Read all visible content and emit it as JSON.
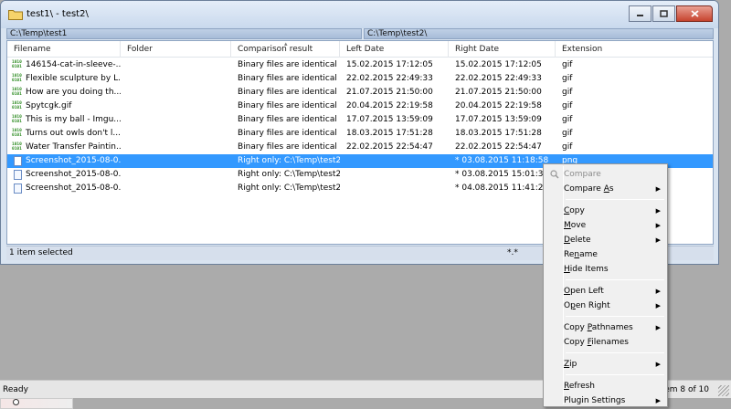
{
  "window": {
    "title": "test1\\ - test2\\",
    "left_path": "C:\\Temp\\test1",
    "right_path": "C:\\Temp\\test2\\"
  },
  "columns": [
    "Filename",
    "Folder",
    "Comparison result",
    "Left Date",
    "Right Date",
    "Extension"
  ],
  "rows": [
    {
      "name": "146154-cat-in-sleeve-...",
      "folder": "",
      "result": "Binary files are identical",
      "left_date": "15.02.2015 17:12:05",
      "right_date": "15.02.2015 17:12:05",
      "ext": "gif",
      "icon": "binary-file-icon"
    },
    {
      "name": "Flexible sculpture by L...",
      "folder": "",
      "result": "Binary files are identical",
      "left_date": "22.02.2015 22:49:33",
      "right_date": "22.02.2015 22:49:33",
      "ext": "gif",
      "icon": "binary-file-icon"
    },
    {
      "name": "How are you doing th...",
      "folder": "",
      "result": "Binary files are identical",
      "left_date": "21.07.2015 21:50:00",
      "right_date": "21.07.2015 21:50:00",
      "ext": "gif",
      "icon": "binary-file-icon"
    },
    {
      "name": "Spytcgk.gif",
      "folder": "",
      "result": "Binary files are identical",
      "left_date": "20.04.2015 22:19:58",
      "right_date": "20.04.2015 22:19:58",
      "ext": "gif",
      "icon": "binary-file-icon"
    },
    {
      "name": "This is my ball - Imgu...",
      "folder": "",
      "result": "Binary files are identical",
      "left_date": "17.07.2015 13:59:09",
      "right_date": "17.07.2015 13:59:09",
      "ext": "gif",
      "icon": "binary-file-icon"
    },
    {
      "name": "Turns out owls don't l...",
      "folder": "",
      "result": "Binary files are identical",
      "left_date": "18.03.2015 17:51:28",
      "right_date": "18.03.2015 17:51:28",
      "ext": "gif",
      "icon": "binary-file-icon"
    },
    {
      "name": "Water Transfer Paintin...",
      "folder": "",
      "result": "Binary files are identical",
      "left_date": "22.02.2015 22:54:47",
      "right_date": "22.02.2015 22:54:47",
      "ext": "gif",
      "icon": "binary-file-icon"
    },
    {
      "name": "Screenshot_2015-08-0...",
      "folder": "",
      "result": "Right only: C:\\Temp\\test2",
      "left_date": "",
      "right_date": "* 03.08.2015 11:18:58",
      "ext": "png",
      "icon": "document-icon",
      "selected": true
    },
    {
      "name": "Screenshot_2015-08-0...",
      "folder": "",
      "result": "Right only: C:\\Temp\\test2",
      "left_date": "",
      "right_date": "* 03.08.2015 15:01:37",
      "ext": "",
      "icon": "document-icon"
    },
    {
      "name": "Screenshot_2015-08-0...",
      "folder": "",
      "result": "Right only: C:\\Temp\\test2",
      "left_date": "",
      "right_date": "* 04.08.2015 11:41:26",
      "ext": "",
      "icon": "document-icon"
    }
  ],
  "status": {
    "selection": "1 item selected",
    "filter": "*.*",
    "app": "Ready",
    "position": "tem 8 of 10"
  },
  "menu": {
    "items": [
      {
        "pre": "",
        "ul": "",
        "post": "Compare",
        "disabled": true,
        "submenu": false,
        "icon": "compare-icon"
      },
      {
        "pre": "Compare ",
        "ul": "A",
        "post": "s",
        "submenu": true
      },
      {
        "sep": true
      },
      {
        "pre": "",
        "ul": "C",
        "post": "opy",
        "submenu": true
      },
      {
        "pre": "",
        "ul": "M",
        "post": "ove",
        "submenu": true
      },
      {
        "pre": "",
        "ul": "D",
        "post": "elete",
        "submenu": true
      },
      {
        "pre": "Re",
        "ul": "n",
        "post": "ame",
        "submenu": false
      },
      {
        "pre": "",
        "ul": "H",
        "post": "ide Items",
        "submenu": false
      },
      {
        "sep": true
      },
      {
        "pre": "",
        "ul": "O",
        "post": "pen Left",
        "submenu": true
      },
      {
        "pre": "O",
        "ul": "p",
        "post": "en Right",
        "submenu": true
      },
      {
        "sep": true
      },
      {
        "pre": "Copy ",
        "ul": "P",
        "post": "athnames",
        "submenu": true
      },
      {
        "pre": "Copy ",
        "ul": "F",
        "post": "ilenames",
        "submenu": false
      },
      {
        "sep": true
      },
      {
        "pre": "",
        "ul": "Z",
        "post": "ip",
        "submenu": true
      },
      {
        "sep": true
      },
      {
        "pre": "",
        "ul": "R",
        "post": "efresh",
        "submenu": false
      },
      {
        "pre": "Plugin Settings",
        "ul": "",
        "post": "",
        "submenu": true
      }
    ]
  },
  "colors": {
    "selection": "#3399ff",
    "binary_icon": "#2a8a1e"
  }
}
